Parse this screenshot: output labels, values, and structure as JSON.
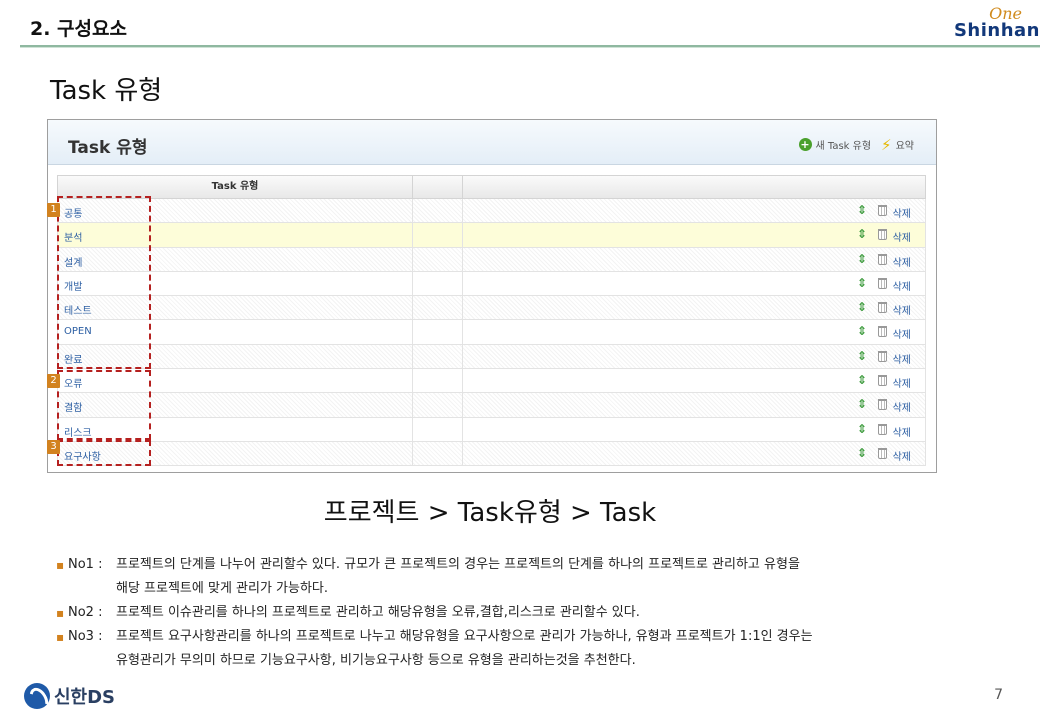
{
  "header": {
    "section_title": "2. 구성요소",
    "brand_top": "One",
    "brand_bottom": "Shinhan"
  },
  "page_heading": "Task 유형",
  "panel": {
    "title": "Task 유형",
    "add_label": "새 Task 유형",
    "summary_label": "요약",
    "column_header": "Task 유형",
    "delete_label": "삭제",
    "rows": [
      {
        "name": "공통"
      },
      {
        "name": "분석"
      },
      {
        "name": "설계"
      },
      {
        "name": "개발"
      },
      {
        "name": "테스트"
      },
      {
        "name": "OPEN"
      },
      {
        "name": "완료"
      },
      {
        "name": "오류"
      },
      {
        "name": "결함"
      },
      {
        "name": "리스크"
      },
      {
        "name": "요구사항"
      }
    ]
  },
  "markers": [
    "1",
    "2",
    "3"
  ],
  "nav_path": "프로젝트 > Task유형 > Task",
  "notes": [
    {
      "num": "No1 :",
      "lines": [
        "프로젝트의 단계를 나누어 관리할수 있다. 규모가 큰 프로젝트의 경우는 프로젝트의 단계를 하나의 프로젝트로 관리하고 유형을",
        "해당 프로젝트에 맞게 관리가 가능하다."
      ]
    },
    {
      "num": "No2 :",
      "lines": [
        "프로젝트 이슈관리를 하나의 프로젝트로 관리하고 해당유형을 오류,결합,리스크로 관리할수 있다."
      ]
    },
    {
      "num": "No3 :",
      "lines": [
        "프로젝트 요구사항관리를 하나의 프로젝트로 나누고 해당유형을 요구사항으로 관리가 가능하나, 유형과 프로젝트가 1:1인 경우는",
        "유형관리가 무의미 하므로 기능요구사항, 비기능요구사항 등으로 유형을 관리하는것을 추천한다."
      ]
    }
  ],
  "footer": {
    "logo_text": "신한DS",
    "page_number": "7"
  },
  "colors": {
    "accent": "#d2821f",
    "annotation": "#b5201f",
    "link": "#2d5fa3",
    "brand": "#12387a"
  }
}
